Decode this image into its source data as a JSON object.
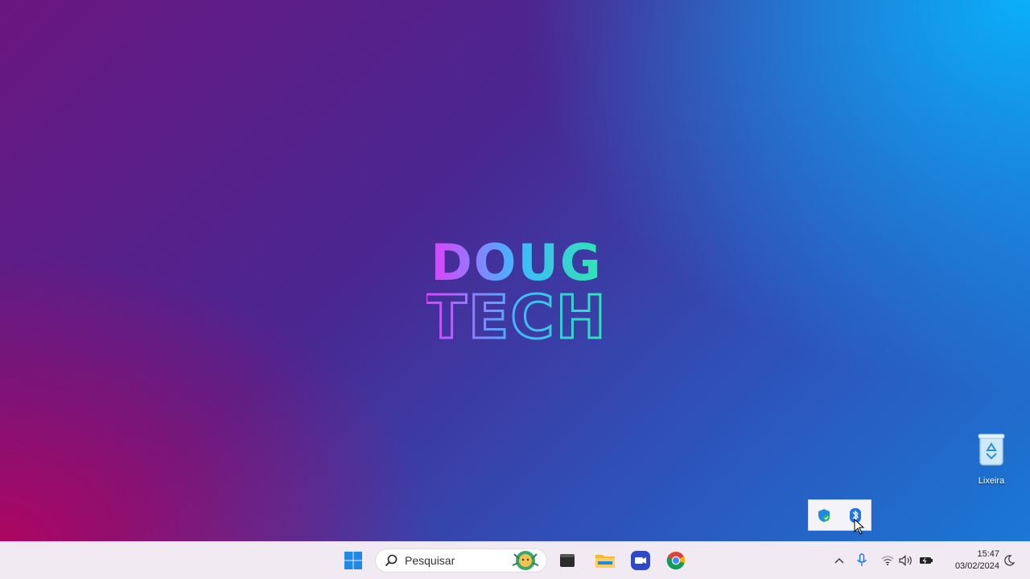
{
  "desktop": {
    "logo": {
      "line1": "DOUG",
      "line2": "TECH"
    },
    "icons": [
      {
        "label": "Lixeira",
        "icon": "recycle-bin-icon"
      }
    ]
  },
  "tray_flyout": {
    "icons": [
      "windows-security-icon",
      "bluetooth-icon"
    ]
  },
  "taskbar": {
    "start_icon": "windows-start-icon",
    "search": {
      "placeholder": "Pesquisar",
      "icon": "search-icon",
      "badge_icon": "search-highlight-icon"
    },
    "pinned": [
      "terminal-icon",
      "file-explorer-icon",
      "video-app-icon",
      "chrome-icon"
    ],
    "system_tray": [
      "chevron-up-icon",
      "microphone-icon",
      "wifi-icon",
      "volume-icon",
      "battery-icon"
    ],
    "clock": {
      "time": "15:47",
      "date": "03/02/2024"
    },
    "notification_icon": "moon-icon"
  },
  "colors": {
    "accent": "#0078d4",
    "taskbar_bg": "#f1eaf2",
    "logo_gradient": [
      "#e040fb",
      "#3fc6ff",
      "#2ee6b0"
    ]
  }
}
